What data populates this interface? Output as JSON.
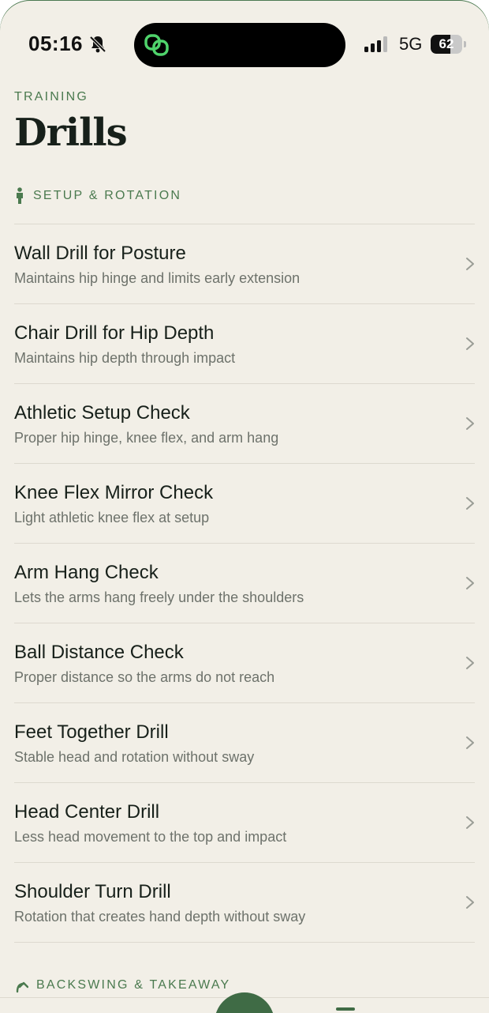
{
  "status_bar": {
    "time": "05:16",
    "network": "5G",
    "battery_percent": "62",
    "battery_level": 0.62,
    "icons": [
      "bell-slash-icon",
      "linked-rings-icon",
      "cellular-signal-icon",
      "battery-icon"
    ]
  },
  "header": {
    "eyebrow": "TRAINING",
    "title": "Drills"
  },
  "sections": [
    {
      "label": "SETUP & ROTATION",
      "icon": "standing-person-icon",
      "items": [
        {
          "title": "Wall Drill for Posture",
          "subtitle": "Maintains hip hinge and limits early extension"
        },
        {
          "title": "Chair Drill for Hip Depth",
          "subtitle": "Maintains hip depth through impact"
        },
        {
          "title": "Athletic Setup Check",
          "subtitle": "Proper hip hinge, knee flex, and arm hang"
        },
        {
          "title": "Knee Flex Mirror Check",
          "subtitle": "Light athletic knee flex at setup"
        },
        {
          "title": "Arm Hang Check",
          "subtitle": "Lets the arms hang freely under the shoulders"
        },
        {
          "title": "Ball Distance Check",
          "subtitle": "Proper distance so the arms do not reach"
        },
        {
          "title": "Feet Together Drill",
          "subtitle": "Stable head and rotation without sway"
        },
        {
          "title": "Head Center Drill",
          "subtitle": "Less head movement to the top and impact"
        },
        {
          "title": "Shoulder Turn Drill",
          "subtitle": "Rotation that creates hand depth without sway"
        }
      ]
    },
    {
      "label": "BACKSWING & TAKEAWAY",
      "icon": "curved-arrow-up-icon",
      "items": []
    }
  ],
  "colors": {
    "background": "#f2efe7",
    "accent": "#4b7a4f",
    "brand_dark": "#3f6b45",
    "title_text": "#17201a",
    "subtitle_text": "#6d726b",
    "divider": "#ddd9cf",
    "island_icon": "#4fd36b"
  }
}
